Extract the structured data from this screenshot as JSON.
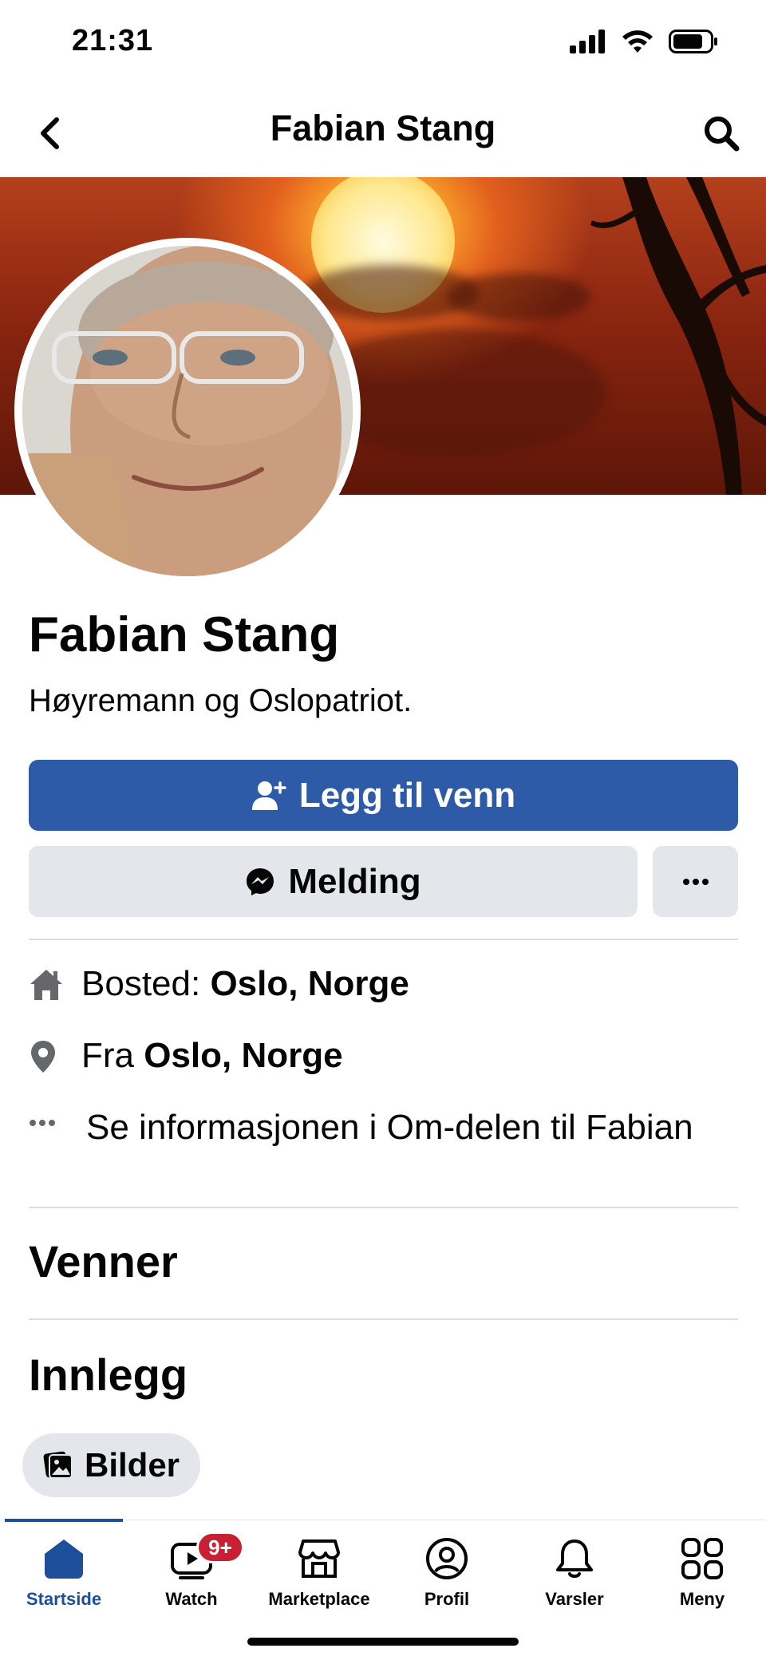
{
  "status_bar": {
    "time": "21:31"
  },
  "nav": {
    "title": "Fabian Stang"
  },
  "profile": {
    "name": "Fabian Stang",
    "bio": "Høyremann og Oslopatriot."
  },
  "actions": {
    "add_friend": "Legg til venn",
    "message": "Melding"
  },
  "info": {
    "residence_label": "Bosted:",
    "residence_value": "Oslo, Norge",
    "from_label": "Fra",
    "from_value": "Oslo, Norge",
    "about_text": "Se informasjonen i Om-delen til Fabian"
  },
  "sections": {
    "friends": "Venner",
    "posts": "Innlegg",
    "photos_chip": "Bilder"
  },
  "tabbar": {
    "items": [
      {
        "label": "Startside",
        "icon": "home-icon",
        "active": true
      },
      {
        "label": "Watch",
        "icon": "watch-icon",
        "badge": "9+"
      },
      {
        "label": "Marketplace",
        "icon": "marketplace-icon"
      },
      {
        "label": "Profil",
        "icon": "profile-icon"
      },
      {
        "label": "Varsler",
        "icon": "bell-icon"
      },
      {
        "label": "Meny",
        "icon": "menu-grid-icon"
      }
    ]
  },
  "colors": {
    "primary_button": "#2d5ba7",
    "secondary_button": "#e4e6eb",
    "active_tab": "#1d4f9a",
    "badge": "#c62032"
  }
}
